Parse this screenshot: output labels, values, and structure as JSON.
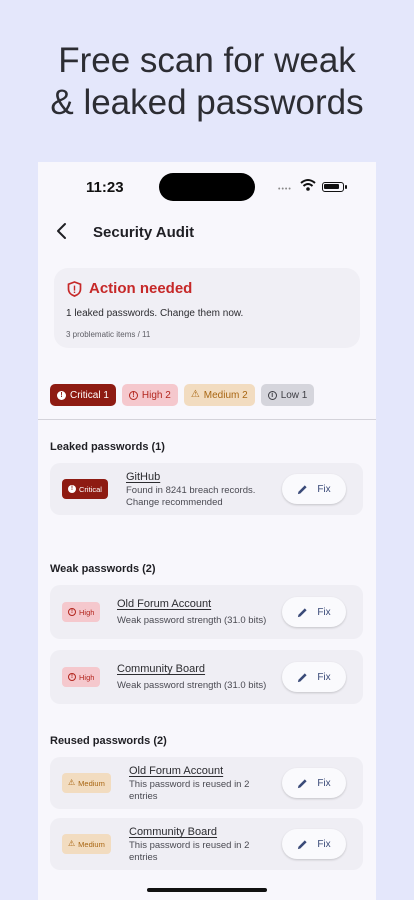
{
  "promo": {
    "line1": "Free scan for weak",
    "line2": "& leaked passwords"
  },
  "status_bar": {
    "time": "11:23"
  },
  "app_bar": {
    "title": "Security Audit"
  },
  "summary": {
    "heading": "Action needed",
    "line1": "1 leaked passwords. Change them now.",
    "line2": "3 problematic items / 11"
  },
  "filters": [
    {
      "label": "Critical 1"
    },
    {
      "label": "High 2"
    },
    {
      "label": "Medium 2"
    },
    {
      "label": "Low 1"
    }
  ],
  "sections": {
    "leaked": {
      "title": "Leaked passwords (1)",
      "items": [
        {
          "severity": "Critical",
          "name": "GitHub",
          "desc1": "Found in 8241 breach records.",
          "desc2": "Change recommended",
          "action": "Fix"
        }
      ]
    },
    "weak": {
      "title": "Weak passwords (2)",
      "items": [
        {
          "severity": "High",
          "name": "Old Forum Account",
          "desc1": "Weak password strength (31.0 bits)",
          "action": "Fix"
        },
        {
          "severity": "High",
          "name": "Community Board",
          "desc1": "Weak password strength (31.0 bits)",
          "action": "Fix"
        }
      ]
    },
    "reused": {
      "title": "Reused passwords (2)",
      "items": [
        {
          "severity": "Medium",
          "name": "Old Forum Account",
          "desc1": "This password is reused in 2",
          "desc2": "entries",
          "action": "Fix"
        },
        {
          "severity": "Medium",
          "name": "Community Board",
          "desc1": "This password is reused in 2",
          "desc2": "entries",
          "action": "Fix"
        }
      ]
    }
  },
  "colors": {
    "page_background": "#e4e7fb",
    "critical": "#8e1b12",
    "high": "#b3261e",
    "medium": "#a86612",
    "action_needed": "#c62828"
  }
}
